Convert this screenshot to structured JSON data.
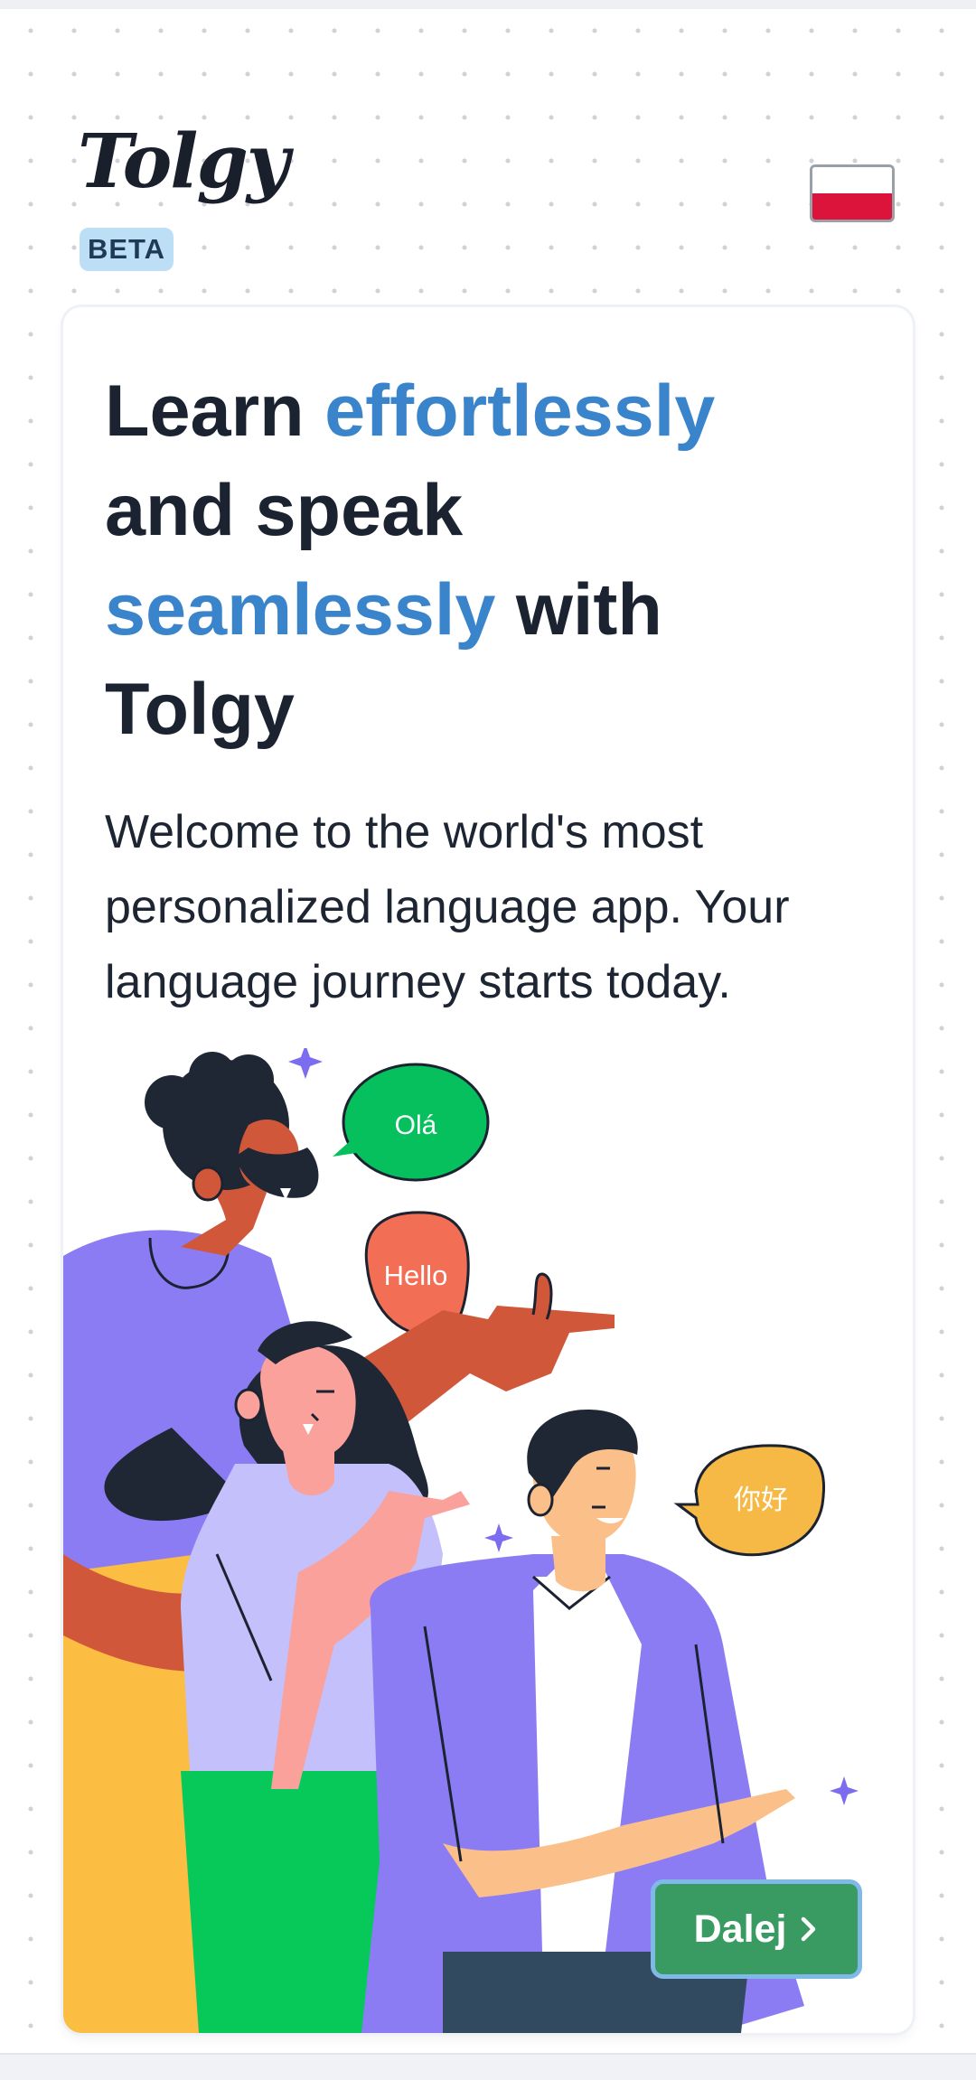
{
  "app": {
    "logo_text": "Tolgy",
    "badge": "BETA",
    "language_flag": "poland-flag-icon"
  },
  "hero": {
    "headline_1": "Learn ",
    "headline_accent_1": "effortlessly",
    "headline_2": "and speak",
    "headline_accent_2": "seamlessly",
    "headline_3": " with",
    "headline_4": "Tolgy",
    "subtitle": "Welcome to the world's most personalized language app. Your language journey starts today."
  },
  "illustration": {
    "bubble_1": "Olá",
    "bubble_2": "Hello",
    "bubble_3": "你好"
  },
  "actions": {
    "next_label": "Dalej",
    "next_icon": "chevron-right-icon"
  },
  "colors": {
    "accent": "#3a84cc",
    "button": "#3a9b62",
    "button_border": "#80b9e8",
    "badge_bg": "#bcdff5"
  }
}
